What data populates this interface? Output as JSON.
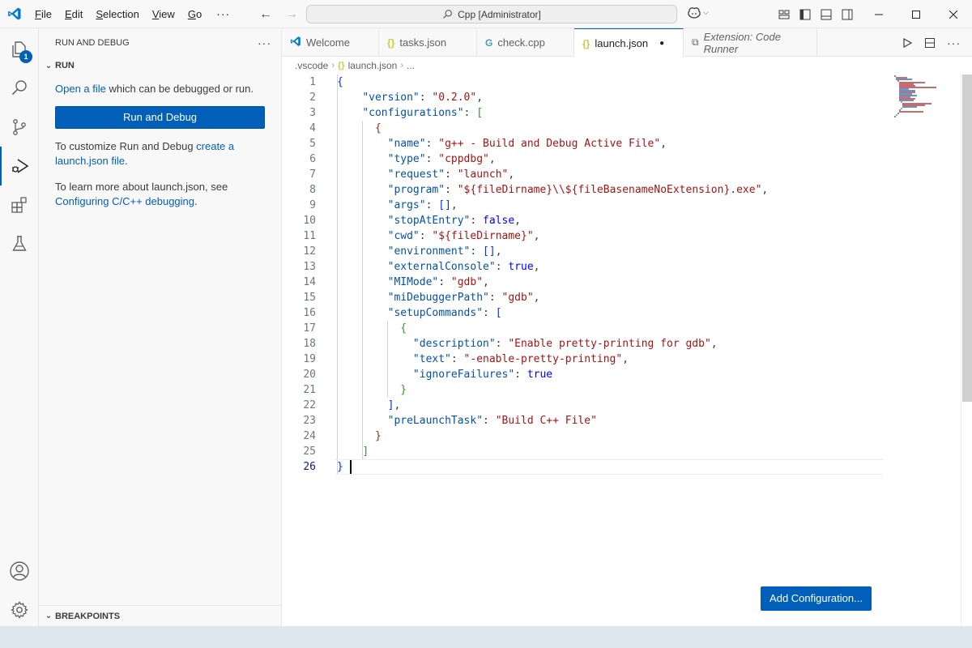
{
  "titlebar": {
    "menu": [
      {
        "u": "F",
        "rest": "ile"
      },
      {
        "u": "E",
        "rest": "dit"
      },
      {
        "u": "S",
        "rest": "election"
      },
      {
        "u": "V",
        "rest": "iew"
      },
      {
        "u": "G",
        "rest": "o"
      }
    ],
    "more": "···",
    "search_text": "Cpp [Administrator]"
  },
  "activity_bar": {
    "explorer_badge": "1"
  },
  "sidebar": {
    "header": "RUN AND DEBUG",
    "header_more": "···",
    "section_run": "RUN",
    "open_file_link": "Open a file",
    "open_file_rest": " which can be debugged or run.",
    "run_button": "Run and Debug",
    "customize_text": "To customize Run and Debug ",
    "customize_link": "create a launch.json file",
    "customize_end": ".",
    "learn_text": "To learn more about launch.json, see ",
    "learn_link": "Configuring C/C++ debugging",
    "learn_end": ".",
    "breakpoints": "BREAKPOINTS"
  },
  "tabs": [
    {
      "label": "Welcome",
      "icon": "vscode-icon"
    },
    {
      "label": "tasks.json",
      "icon": "json-icon"
    },
    {
      "label": "check.cpp",
      "icon": "cpp-icon"
    },
    {
      "label": "launch.json",
      "icon": "json-icon",
      "active": true,
      "dirty": true
    },
    {
      "label": "Extension: Code Runner",
      "icon": "extension-icon"
    }
  ],
  "breadcrumb": {
    "folder": ".vscode",
    "file": "launch.json",
    "tail": "..."
  },
  "code": {
    "current_line": 26,
    "lines": [
      {
        "n": "1",
        "parts": [
          {
            "c": "br1",
            "t": "{"
          }
        ]
      },
      {
        "n": "2",
        "parts": [
          {
            "c": "p",
            "t": "    "
          },
          {
            "c": "k",
            "t": "\"version\""
          },
          {
            "c": "p",
            "t": ": "
          },
          {
            "c": "s",
            "t": "\"0.2.0\""
          },
          {
            "c": "p",
            "t": ","
          }
        ]
      },
      {
        "n": "3",
        "parts": [
          {
            "c": "p",
            "t": "    "
          },
          {
            "c": "k",
            "t": "\"configurations\""
          },
          {
            "c": "p",
            "t": ": "
          },
          {
            "c": "br2",
            "t": "["
          }
        ]
      },
      {
        "n": "4",
        "parts": [
          {
            "c": "p",
            "t": "      "
          },
          {
            "c": "br3",
            "t": "{"
          }
        ]
      },
      {
        "n": "5",
        "parts": [
          {
            "c": "p",
            "t": "        "
          },
          {
            "c": "k",
            "t": "\"name\""
          },
          {
            "c": "p",
            "t": ": "
          },
          {
            "c": "s",
            "t": "\"g++ - Build and Debug Active File\""
          },
          {
            "c": "p",
            "t": ","
          }
        ]
      },
      {
        "n": "6",
        "parts": [
          {
            "c": "p",
            "t": "        "
          },
          {
            "c": "k",
            "t": "\"type\""
          },
          {
            "c": "p",
            "t": ": "
          },
          {
            "c": "s",
            "t": "\"cppdbg\""
          },
          {
            "c": "p",
            "t": ","
          }
        ]
      },
      {
        "n": "7",
        "parts": [
          {
            "c": "p",
            "t": "        "
          },
          {
            "c": "k",
            "t": "\"request\""
          },
          {
            "c": "p",
            "t": ": "
          },
          {
            "c": "s",
            "t": "\"launch\""
          },
          {
            "c": "p",
            "t": ","
          }
        ]
      },
      {
        "n": "8",
        "parts": [
          {
            "c": "p",
            "t": "        "
          },
          {
            "c": "k",
            "t": "\"program\""
          },
          {
            "c": "p",
            "t": ": "
          },
          {
            "c": "s",
            "t": "\"${fileDirname}\\\\${fileBasenameNoExtension}.exe\""
          },
          {
            "c": "p",
            "t": ","
          }
        ]
      },
      {
        "n": "9",
        "parts": [
          {
            "c": "p",
            "t": "        "
          },
          {
            "c": "k",
            "t": "\"args\""
          },
          {
            "c": "p",
            "t": ": "
          },
          {
            "c": "br1",
            "t": "[]"
          },
          {
            "c": "p",
            "t": ","
          }
        ]
      },
      {
        "n": "10",
        "parts": [
          {
            "c": "p",
            "t": "        "
          },
          {
            "c": "k",
            "t": "\"stopAtEntry\""
          },
          {
            "c": "p",
            "t": ": "
          },
          {
            "c": "b",
            "t": "false"
          },
          {
            "c": "p",
            "t": ","
          }
        ]
      },
      {
        "n": "11",
        "parts": [
          {
            "c": "p",
            "t": "        "
          },
          {
            "c": "k",
            "t": "\"cwd\""
          },
          {
            "c": "p",
            "t": ": "
          },
          {
            "c": "s",
            "t": "\"${fileDirname}\""
          },
          {
            "c": "p",
            "t": ","
          }
        ]
      },
      {
        "n": "12",
        "parts": [
          {
            "c": "p",
            "t": "        "
          },
          {
            "c": "k",
            "t": "\"environment\""
          },
          {
            "c": "p",
            "t": ": "
          },
          {
            "c": "br1",
            "t": "[]"
          },
          {
            "c": "p",
            "t": ","
          }
        ]
      },
      {
        "n": "13",
        "parts": [
          {
            "c": "p",
            "t": "        "
          },
          {
            "c": "k",
            "t": "\"externalConsole\""
          },
          {
            "c": "p",
            "t": ": "
          },
          {
            "c": "b",
            "t": "true"
          },
          {
            "c": "p",
            "t": ","
          }
        ]
      },
      {
        "n": "14",
        "parts": [
          {
            "c": "p",
            "t": "        "
          },
          {
            "c": "k",
            "t": "\"MIMode\""
          },
          {
            "c": "p",
            "t": ": "
          },
          {
            "c": "s",
            "t": "\"gdb\""
          },
          {
            "c": "p",
            "t": ","
          }
        ]
      },
      {
        "n": "15",
        "parts": [
          {
            "c": "p",
            "t": "        "
          },
          {
            "c": "k",
            "t": "\"miDebuggerPath\""
          },
          {
            "c": "p",
            "t": ": "
          },
          {
            "c": "s",
            "t": "\"gdb\""
          },
          {
            "c": "p",
            "t": ","
          }
        ]
      },
      {
        "n": "16",
        "parts": [
          {
            "c": "p",
            "t": "        "
          },
          {
            "c": "k",
            "t": "\"setupCommands\""
          },
          {
            "c": "p",
            "t": ": "
          },
          {
            "c": "br1",
            "t": "["
          }
        ]
      },
      {
        "n": "17",
        "parts": [
          {
            "c": "p",
            "t": "          "
          },
          {
            "c": "br2",
            "t": "{"
          }
        ]
      },
      {
        "n": "18",
        "parts": [
          {
            "c": "p",
            "t": "            "
          },
          {
            "c": "k",
            "t": "\"description\""
          },
          {
            "c": "p",
            "t": ": "
          },
          {
            "c": "s",
            "t": "\"Enable pretty-printing for gdb\""
          },
          {
            "c": "p",
            "t": ","
          }
        ]
      },
      {
        "n": "19",
        "parts": [
          {
            "c": "p",
            "t": "            "
          },
          {
            "c": "k",
            "t": "\"text\""
          },
          {
            "c": "p",
            "t": ": "
          },
          {
            "c": "s",
            "t": "\"-enable-pretty-printing\""
          },
          {
            "c": "p",
            "t": ","
          }
        ]
      },
      {
        "n": "20",
        "parts": [
          {
            "c": "p",
            "t": "            "
          },
          {
            "c": "k",
            "t": "\"ignoreFailures\""
          },
          {
            "c": "p",
            "t": ": "
          },
          {
            "c": "b",
            "t": "true"
          }
        ]
      },
      {
        "n": "21",
        "parts": [
          {
            "c": "p",
            "t": "          "
          },
          {
            "c": "br2",
            "t": "}"
          }
        ]
      },
      {
        "n": "22",
        "parts": [
          {
            "c": "p",
            "t": "        "
          },
          {
            "c": "br1",
            "t": "]"
          },
          {
            "c": "p",
            "t": ","
          }
        ]
      },
      {
        "n": "23",
        "parts": [
          {
            "c": "p",
            "t": "        "
          },
          {
            "c": "k",
            "t": "\"preLaunchTask\""
          },
          {
            "c": "p",
            "t": ": "
          },
          {
            "c": "s",
            "t": "\"Build C++ File\""
          }
        ]
      },
      {
        "n": "24",
        "parts": [
          {
            "c": "p",
            "t": "      "
          },
          {
            "c": "br3",
            "t": "}"
          }
        ]
      },
      {
        "n": "25",
        "parts": [
          {
            "c": "p",
            "t": "    "
          },
          {
            "c": "br2",
            "t": "]"
          }
        ]
      },
      {
        "n": "26",
        "parts": [
          {
            "c": "br1",
            "t": "}"
          }
        ]
      }
    ]
  },
  "editor": {
    "add_configuration": "Add Configuration..."
  },
  "colors": {
    "accent": "#005fb8",
    "json_key": "#0451a5",
    "json_string": "#a31515",
    "json_literal": "#0000ff"
  }
}
